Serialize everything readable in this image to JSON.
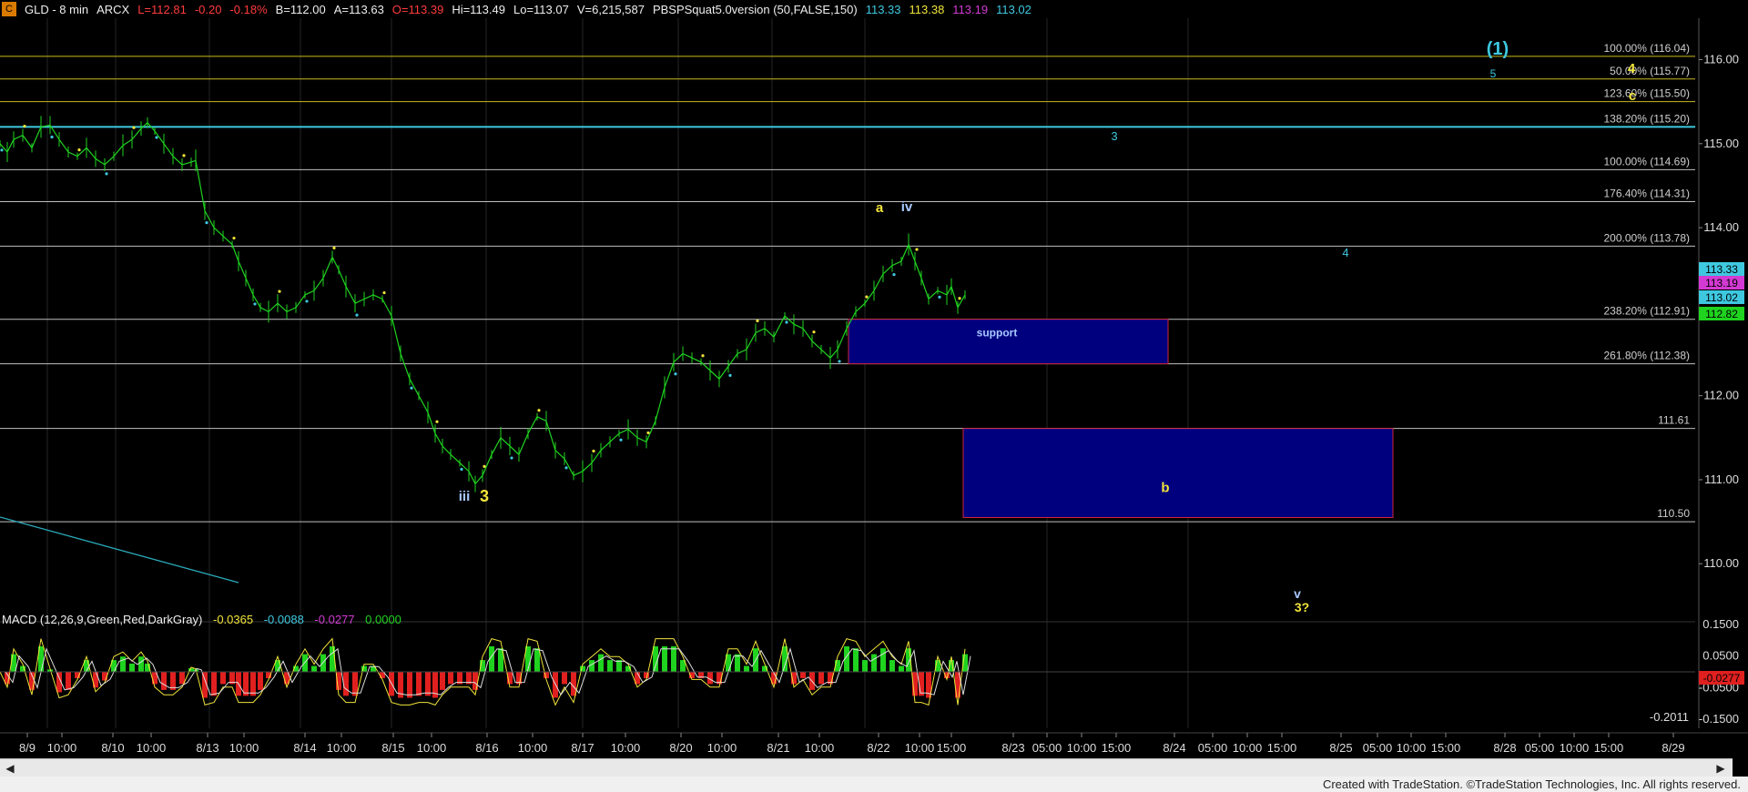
{
  "window": {
    "symbol": "GLD - 8 min",
    "exchange": "ARCX",
    "last": "L=112.81",
    "change": "-0.20",
    "change_pct": "-0.18%",
    "bid": "B=112.00",
    "ask": "A=113.63",
    "open": "O=113.39",
    "high": "Hi=113.49",
    "low": "Lo=113.07",
    "volume": "V=6,215,587",
    "study": "PBSPSquat5.0version (50,FALSE,150)",
    "study_values": [
      "113.33",
      "113.38",
      "113.19",
      "113.02"
    ],
    "colors": {
      "bg": "#000000",
      "grid": "#2a2a2a",
      "price": "#1fd31f",
      "header": "#dddddd",
      "cyan": "#3ec8e0",
      "yellow": "#f1e43a",
      "magenta": "#d33ad3",
      "blue_box": "#00007f",
      "box_border": "#d0243a",
      "macd_up": "#1fd31f",
      "macd_down": "#e0201f"
    }
  },
  "chart_data": {
    "type": "line",
    "price_axis": {
      "ticks": [
        "116.00",
        "115.00",
        "114.00",
        "113.00",
        "112.00",
        "111.00",
        "110.00"
      ],
      "range": [
        109.45,
        116.45
      ]
    },
    "time_axis": [
      "8/9",
      "10:00",
      "8/10",
      "10:00",
      "8/13",
      "10:00",
      "8/14",
      "10:00",
      "8/15",
      "10:00",
      "8/16",
      "10:00",
      "8/17",
      "10:00",
      "8/20",
      "10:00",
      "8/21",
      "10:00",
      "8/22",
      "10:00",
      "15:00",
      "8/23",
      "05:00",
      "10:00",
      "15:00",
      "8/24",
      "05:00",
      "10:00",
      "15:00",
      "8/25",
      "05:00",
      "10:00",
      "15:00",
      "8/28",
      "05:00",
      "10:00",
      "15:00",
      "8/29"
    ],
    "fib_levels": [
      {
        "label": "100.00% (116.04)",
        "value": 116.04
      },
      {
        "label": "50.00% (115.77)",
        "value": 115.77
      },
      {
        "label": "123.60% (115.50)",
        "value": 115.5
      },
      {
        "label": "138.20% (115.20)",
        "value": 115.2
      },
      {
        "label": "100.00% (114.69)",
        "value": 114.69
      },
      {
        "label": "176.40% (114.31)",
        "value": 114.31
      },
      {
        "label": "200.00% (113.78)",
        "value": 113.78
      },
      {
        "label": "238.20% (112.91)",
        "value": 112.91
      },
      {
        "label": "261.80% (112.38)",
        "value": 112.38
      },
      {
        "label": "111.61",
        "value": 111.61
      },
      {
        "label": "110.50",
        "value": 110.5
      }
    ],
    "boxes": [
      {
        "label": "support",
        "x_start_day": 15.0,
        "x_end_day": 21.0,
        "top": 112.91,
        "bottom": 112.38
      },
      {
        "label": "b",
        "x_start_day": 16.0,
        "x_end_day": 23.0,
        "top": 111.61,
        "bottom": 110.55
      }
    ],
    "wave_labels": [
      "(1)",
      "5",
      "c",
      "3",
      "a",
      "iv",
      "4",
      "iii",
      "3",
      "v",
      "3?",
      "4"
    ],
    "price_tags": [
      {
        "value": "113.33",
        "color": "#3ec8e0"
      },
      {
        "value": "113.19",
        "color": "#d33ad3"
      },
      {
        "value": "113.02",
        "color": "#3ec8e0"
      },
      {
        "value": "112.82",
        "color": "#1fd31f"
      }
    ],
    "macd": {
      "label": "MACD (12,26,9,Green,Red,DarkGray)",
      "values": [
        "-0.0365",
        "-0.0088",
        "-0.0277",
        "0.0000"
      ],
      "value_colors": [
        "#f1e43a",
        "#3ec8e0",
        "#d33ad3",
        "#1fd31f"
      ],
      "ticks": [
        "0.1500",
        "0.0500",
        "-0.0500",
        "-0.1500"
      ],
      "last_tag": "-0.0277",
      "min_label": "-0.2011"
    },
    "price_path": [
      [
        0,
        115.0
      ],
      [
        8,
        114.9
      ],
      [
        15,
        115.05
      ],
      [
        25,
        115.1
      ],
      [
        35,
        114.95
      ],
      [
        45,
        115.2
      ],
      [
        55,
        115.22
      ],
      [
        65,
        115.05
      ],
      [
        75,
        114.9
      ],
      [
        85,
        114.85
      ],
      [
        95,
        114.95
      ],
      [
        105,
        114.82
      ],
      [
        115,
        114.75
      ],
      [
        125,
        114.85
      ],
      [
        135,
        114.98
      ],
      [
        145,
        115.05
      ],
      [
        155,
        115.18
      ],
      [
        162,
        115.25
      ],
      [
        170,
        115.15
      ],
      [
        180,
        115.0
      ],
      [
        190,
        114.85
      ],
      [
        200,
        114.75
      ],
      [
        210,
        114.78
      ],
      [
        215,
        114.8
      ],
      [
        225,
        114.2
      ],
      [
        235,
        114.0
      ],
      [
        245,
        113.9
      ],
      [
        255,
        113.8
      ],
      [
        262,
        113.6
      ],
      [
        270,
        113.4
      ],
      [
        278,
        113.2
      ],
      [
        286,
        113.05
      ],
      [
        295,
        113.0
      ],
      [
        305,
        113.1
      ],
      [
        315,
        113.0
      ],
      [
        325,
        113.05
      ],
      [
        335,
        113.2
      ],
      [
        345,
        113.25
      ],
      [
        355,
        113.4
      ],
      [
        365,
        113.65
      ],
      [
        372,
        113.5
      ],
      [
        380,
        113.3
      ],
      [
        390,
        113.1
      ],
      [
        400,
        113.15
      ],
      [
        410,
        113.2
      ],
      [
        420,
        113.15
      ],
      [
        430,
        112.95
      ],
      [
        440,
        112.5
      ],
      [
        450,
        112.2
      ],
      [
        460,
        112.0
      ],
      [
        470,
        111.8
      ],
      [
        478,
        111.55
      ],
      [
        486,
        111.4
      ],
      [
        495,
        111.3
      ],
      [
        505,
        111.2
      ],
      [
        515,
        111.1
      ],
      [
        522,
        110.95
      ],
      [
        530,
        111.05
      ],
      [
        540,
        111.3
      ],
      [
        550,
        111.5
      ],
      [
        560,
        111.4
      ],
      [
        570,
        111.3
      ],
      [
        580,
        111.55
      ],
      [
        590,
        111.75
      ],
      [
        600,
        111.7
      ],
      [
        610,
        111.35
      ],
      [
        620,
        111.25
      ],
      [
        630,
        111.05
      ],
      [
        640,
        111.1
      ],
      [
        650,
        111.2
      ],
      [
        660,
        111.35
      ],
      [
        670,
        111.45
      ],
      [
        680,
        111.55
      ],
      [
        690,
        111.6
      ],
      [
        700,
        111.5
      ],
      [
        710,
        111.45
      ],
      [
        720,
        111.7
      ],
      [
        730,
        112.1
      ],
      [
        740,
        112.4
      ],
      [
        750,
        112.5
      ],
      [
        760,
        112.45
      ],
      [
        770,
        112.4
      ],
      [
        780,
        112.3
      ],
      [
        790,
        112.2
      ],
      [
        800,
        112.35
      ],
      [
        810,
        112.5
      ],
      [
        820,
        112.55
      ],
      [
        830,
        112.75
      ],
      [
        840,
        112.8
      ],
      [
        850,
        112.7
      ],
      [
        862,
        112.95
      ],
      [
        872,
        112.85
      ],
      [
        882,
        112.8
      ],
      [
        892,
        112.65
      ],
      [
        902,
        112.55
      ],
      [
        912,
        112.45
      ],
      [
        920,
        112.55
      ],
      [
        930,
        112.8
      ],
      [
        940,
        113.0
      ],
      [
        950,
        113.1
      ],
      [
        960,
        113.25
      ],
      [
        970,
        113.45
      ],
      [
        980,
        113.55
      ],
      [
        990,
        113.6
      ],
      [
        998,
        113.8
      ],
      [
        1005,
        113.6
      ],
      [
        1012,
        113.4
      ],
      [
        1020,
        113.15
      ],
      [
        1030,
        113.25
      ],
      [
        1040,
        113.2
      ],
      [
        1045,
        113.3
      ],
      [
        1052,
        113.05
      ],
      [
        1060,
        113.2
      ]
    ]
  }
}
